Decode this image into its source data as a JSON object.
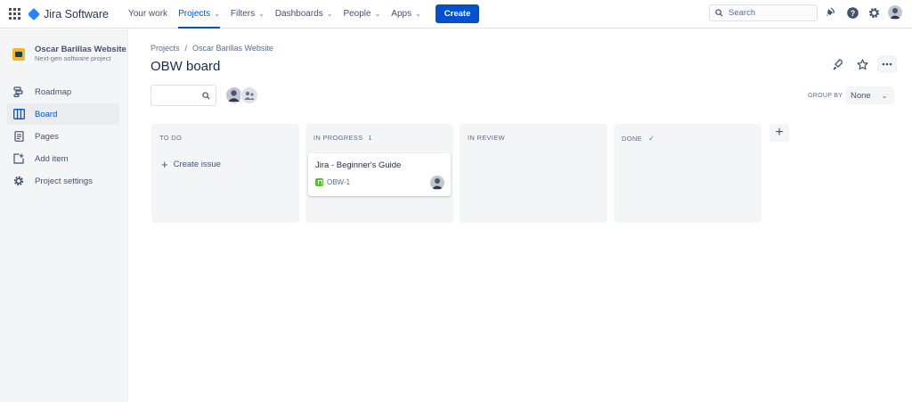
{
  "topnav": {
    "app_name": "Jira Software",
    "items": [
      {
        "label": "Your work",
        "dropdown": false,
        "active": false
      },
      {
        "label": "Projects",
        "dropdown": true,
        "active": true
      },
      {
        "label": "Filters",
        "dropdown": true,
        "active": false
      },
      {
        "label": "Dashboards",
        "dropdown": true,
        "active": false
      },
      {
        "label": "People",
        "dropdown": true,
        "active": false
      },
      {
        "label": "Apps",
        "dropdown": true,
        "active": false
      }
    ],
    "create_label": "Create",
    "search_placeholder": "Search",
    "accent": "#0052CC"
  },
  "sidebar": {
    "project_name": "Oscar Barillas Website",
    "project_type": "Next-gen software project",
    "items": [
      {
        "label": "Roadmap",
        "icon": "roadmap-icon",
        "active": false
      },
      {
        "label": "Board",
        "icon": "board-icon",
        "active": true
      },
      {
        "label": "Pages",
        "icon": "pages-icon",
        "active": false
      },
      {
        "label": "Add item",
        "icon": "add-item-icon",
        "active": false
      },
      {
        "label": "Project settings",
        "icon": "settings-icon",
        "active": false
      }
    ]
  },
  "main": {
    "breadcrumb": [
      "Projects",
      "Oscar Barillas Website"
    ],
    "title": "OBW board",
    "group_by_label": "GROUP BY",
    "group_by_value": "None",
    "columns": [
      {
        "title": "TO DO",
        "count": "",
        "create_label": "Create issue"
      },
      {
        "title": "IN PROGRESS",
        "count": "1"
      },
      {
        "title": "IN REVIEW",
        "count": ""
      },
      {
        "title": "DONE",
        "count": ""
      }
    ],
    "card": {
      "title": "Jira - Beginner's Guide",
      "key": "OBW-1"
    }
  }
}
